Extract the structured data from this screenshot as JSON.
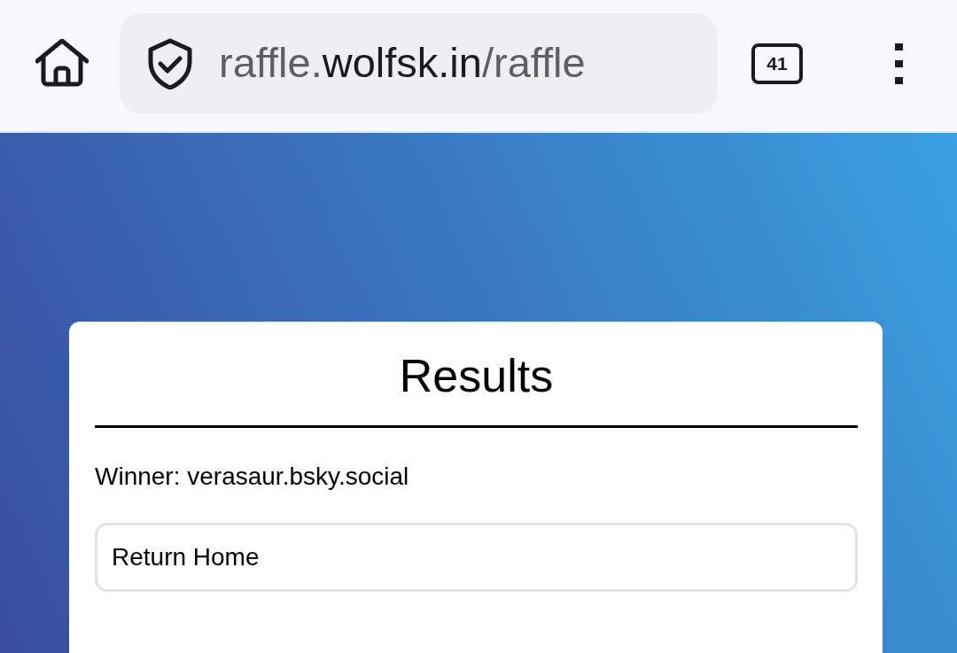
{
  "browser_bar": {
    "url": {
      "subdomain": "raffle.",
      "domain": "wolfsk.in",
      "path": "/raffle"
    },
    "secure": true,
    "tab_count": "41"
  },
  "results_card": {
    "title": "Results",
    "winner_text": "Winner: verasaur.bsky.social",
    "buttons": [
      {
        "label": "Return Home"
      }
    ]
  }
}
